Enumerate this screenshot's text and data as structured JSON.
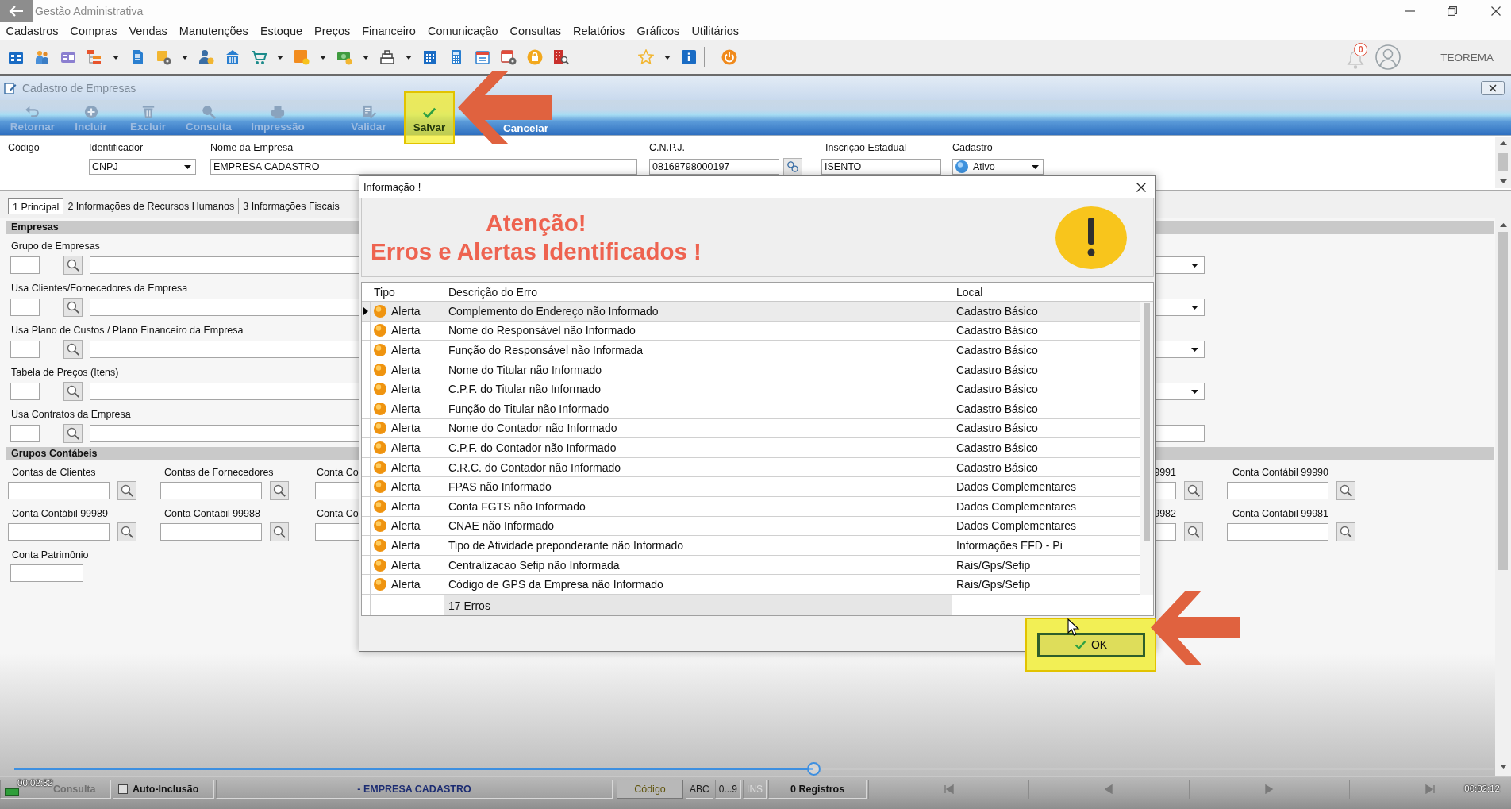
{
  "window": {
    "title": "Gestão Administrativa"
  },
  "menu": [
    "Cadastros",
    "Compras",
    "Vendas",
    "Manutenções",
    "Estoque",
    "Preços",
    "Financeiro",
    "Comunicação",
    "Consultas",
    "Relatórios",
    "Gráficos",
    "Utilitários"
  ],
  "toolbar": {
    "notification_count": "0",
    "user_name": "TEOREMA"
  },
  "form_window": {
    "title": "Cadastro de Empresas",
    "actions": [
      {
        "label": "Retornar",
        "disabled": true,
        "highlighted": false
      },
      {
        "label": "Incluir",
        "disabled": true,
        "highlighted": false
      },
      {
        "label": "Excluir",
        "disabled": true,
        "highlighted": false
      },
      {
        "label": "Consulta",
        "disabled": true,
        "highlighted": false
      },
      {
        "label": "Impressão",
        "disabled": true,
        "highlighted": false
      },
      {
        "label": "Validar",
        "disabled": true,
        "highlighted": false
      },
      {
        "label": "Salvar",
        "disabled": false,
        "highlighted": true
      },
      {
        "label": "Cancelar",
        "disabled": false,
        "highlighted": false
      }
    ],
    "header_fields": [
      {
        "label": "Código",
        "kind": "label"
      },
      {
        "label": "Identificador",
        "kind": "combo",
        "value": "CNPJ"
      },
      {
        "label": "Nome da Empresa",
        "kind": "text",
        "value": "EMPRESA CADASTRO"
      },
      {
        "label": "C.N.P.J.",
        "kind": "lookup",
        "value": "08168798000197"
      },
      {
        "label": "Inscrição Estadual",
        "kind": "text",
        "value": "ISENTO"
      },
      {
        "label": "Cadastro",
        "kind": "status",
        "value": "Ativo"
      }
    ],
    "tabs": [
      {
        "label": "1 Principal",
        "selected": true
      },
      {
        "label": "2 Informações de Recursos Humanos",
        "selected": false
      },
      {
        "label": "3 Informações Fiscais",
        "selected": false
      }
    ],
    "company_links": {
      "title": "Empresas",
      "rows": [
        {
          "label": "Grupo de Empresas",
          "dropdown": true
        },
        {
          "label": "Usa Clientes/Fornecedores da Empresa",
          "dropdown": true
        },
        {
          "label": "Usa Plano de Custos / Plano Financeiro da Empresa",
          "dropdown": true
        },
        {
          "label": "Tabela de Preços (Itens)",
          "dropdown": true
        },
        {
          "label": "Usa Contratos da Empresa",
          "dropdown": false
        }
      ]
    },
    "accounting_groups": {
      "title": "Grupos Contábeis",
      "rows": [
        {
          "left": [
            {
              "label": "Contas de Clientes",
              "kind": "lookup"
            },
            {
              "label": "Contas de Fornecedores",
              "kind": "lookup"
            },
            {
              "label": "Conta Co",
              "kind": "plain"
            }
          ],
          "right": [
            {
              "label": "9991",
              "kind": "lookup"
            },
            {
              "label": "Conta Contábil 99990",
              "kind": "lookup"
            }
          ]
        },
        {
          "left": [
            {
              "label": "Conta Contábil 99989",
              "kind": "lookup"
            },
            {
              "label": "Conta Contábil 99988",
              "kind": "lookup"
            },
            {
              "label": "Conta Co",
              "kind": "plain"
            }
          ],
          "right": [
            {
              "label": "9982",
              "kind": "lookup"
            },
            {
              "label": "Conta Contábil 99981",
              "kind": "lookup"
            }
          ]
        },
        {
          "left": [
            {
              "label": "Conta Patrimônio",
              "kind": "plain"
            }
          ]
        }
      ]
    }
  },
  "dialog": {
    "title": "Informação !",
    "heading": "Atenção!",
    "subheading": "Erros e Alertas Identificados !",
    "columns": [
      "Tipo",
      "Descrição do Erro",
      "Local"
    ],
    "rows": [
      {
        "type": "Alerta",
        "description": "Complemento do Endereço não Informado",
        "local": "Cadastro Básico",
        "selected": true
      },
      {
        "type": "Alerta",
        "description": "Nome do Responsável não Informado",
        "local": "Cadastro Básico",
        "selected": false
      },
      {
        "type": "Alerta",
        "description": "Função do Responsável não Informada",
        "local": "Cadastro Básico",
        "selected": false
      },
      {
        "type": "Alerta",
        "description": "Nome do Titular não Informado",
        "local": "Cadastro Básico",
        "selected": false
      },
      {
        "type": "Alerta",
        "description": "C.P.F. do Titular não Informado",
        "local": "Cadastro Básico",
        "selected": false
      },
      {
        "type": "Alerta",
        "description": "Função do Titular não Informado",
        "local": "Cadastro Básico",
        "selected": false
      },
      {
        "type": "Alerta",
        "description": "Nome do Contador não Informado",
        "local": "Cadastro Básico",
        "selected": false
      },
      {
        "type": "Alerta",
        "description": "C.P.F. do Contador não Informado",
        "local": "Cadastro Básico",
        "selected": false
      },
      {
        "type": "Alerta",
        "description": "C.R.C. do Contador não Informado",
        "local": "Cadastro Básico",
        "selected": false
      },
      {
        "type": "Alerta",
        "description": "FPAS não Informado",
        "local": "Dados Complementares",
        "selected": false
      },
      {
        "type": "Alerta",
        "description": "Conta FGTS não Informado",
        "local": "Dados Complementares",
        "selected": false
      },
      {
        "type": "Alerta",
        "description": "CNAE não Informado",
        "local": "Dados Complementares",
        "selected": false
      },
      {
        "type": "Alerta",
        "description": "Tipo de Atividade preponderante não Informado",
        "local": "Informações EFD - Pi",
        "selected": false
      },
      {
        "type": "Alerta",
        "description": "Centralizacao Sefip não Informada",
        "local": "Rais/Gps/Sefip",
        "selected": false
      },
      {
        "type": "Alerta",
        "description": "Código de GPS da Empresa não Informado",
        "local": "Rais/Gps/Sefip",
        "selected": false
      }
    ],
    "footer": "17 Erros",
    "ok_button": {
      "label": "OK",
      "highlighted": true
    }
  },
  "status_bar": {
    "mode": "Consulta",
    "auto_include": {
      "label": "Auto-Inclusão",
      "checked": false
    },
    "record_title": "- EMPRESA CADASTRO",
    "index_field": "Código",
    "indicators": [
      {
        "label": "ABC",
        "on": true
      },
      {
        "label": "0...9",
        "on": true
      },
      {
        "label": "INS",
        "on": false
      }
    ],
    "record_count": "0 Registros"
  },
  "video_player": {
    "time_elapsed": "00:02:32",
    "time_remaining": "00:02:12",
    "progress": {
      "level": 0.54
    }
  }
}
